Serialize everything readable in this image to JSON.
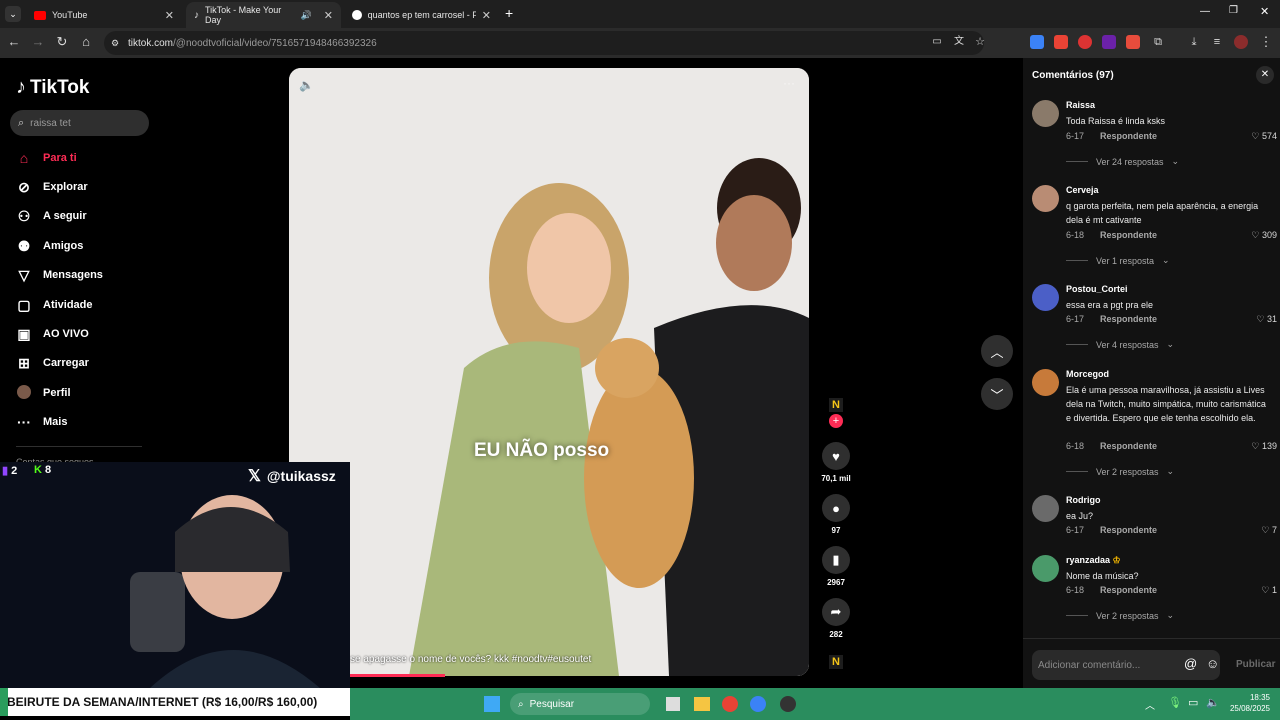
{
  "browser": {
    "tabs": [
      {
        "title": "YouTube",
        "active": false
      },
      {
        "title": "TikTok - Make Your Day",
        "active": true
      },
      {
        "title": "quantos ep tem carrosel - Pesq",
        "active": false
      }
    ],
    "url_host": "tiktok.com",
    "url_path": "/@noodtvoficial/video/7516571948466392326"
  },
  "sidebar": {
    "logo": "TikTok",
    "search_placeholder": "raissa tet",
    "items": [
      {
        "label": "Para ti",
        "icon": "home-icon",
        "active": true
      },
      {
        "label": "Explorar",
        "icon": "compass-icon"
      },
      {
        "label": "A seguir",
        "icon": "following-icon"
      },
      {
        "label": "Amigos",
        "icon": "friends-icon"
      },
      {
        "label": "Mensagens",
        "icon": "messages-icon"
      },
      {
        "label": "Atividade",
        "icon": "activity-icon"
      },
      {
        "label": "AO VIVO",
        "icon": "live-icon"
      },
      {
        "label": "Carregar",
        "icon": "upload-icon"
      },
      {
        "label": "Perfil",
        "icon": "profile-icon"
      },
      {
        "label": "Mais",
        "icon": "more-icon"
      }
    ],
    "partial_text": "Contas que segues"
  },
  "video": {
    "overlay_text": "EU NÃO posso",
    "caption": "se apagasse o nome de vocês? kkk #noodtv#eusoutet",
    "likes": "70,1 mil",
    "comments": "97",
    "saves": "2967",
    "shares": "282"
  },
  "comments": {
    "title": "Comentários (97)",
    "placeholder": "Adicionar comentário...",
    "post_label": "Publicar",
    "items": [
      {
        "user": "Raissa",
        "text": "Toda Raissa é linda ksks",
        "date": "6-17",
        "reply": "Respondente",
        "likes": "574",
        "replies": "Ver 24 respostas"
      },
      {
        "user": "Cerveja",
        "text": "q garota perfeita, nem pela aparência, a energia dela é mt cativante",
        "date": "6-18",
        "reply": "Respondente",
        "likes": "309",
        "replies": "Ver 1 resposta"
      },
      {
        "user": "Postou_Cortei",
        "text": "essa era a pgt pra ele",
        "date": "6-17",
        "reply": "Respondente",
        "likes": "31",
        "replies": "Ver 4 respostas"
      },
      {
        "user": "Morcegod",
        "text": "Ela é uma pessoa maravilhosa, já assistiu a Lives dela na Twitch, muito simpática, muito carismática e divertida. Espero que ele tenha escolhido ela.",
        "date": "6-18",
        "reply": "Respondente",
        "likes": "139",
        "replies": "Ver 2 respostas"
      },
      {
        "user": "Rodrigo",
        "text": "ea Ju?",
        "date": "6-17",
        "reply": "Respondente",
        "likes": "7",
        "replies": ""
      },
      {
        "user": "ryanzadaa",
        "text": "Nome da música?",
        "date": "6-18",
        "reply": "Respondente",
        "likes": "1",
        "replies": "Ver 2 respostas"
      }
    ]
  },
  "stream": {
    "handle": "@tuikassz",
    "count_a": "2",
    "count_b": "8",
    "banner": "BEIRUTE DA SEMANA/INTERNET (R$ 16,00/R$ 160,00)"
  },
  "taskbar": {
    "search": "Pesquisar",
    "time": "18:35",
    "date": "25/08/2025"
  },
  "colors": {
    "accent": "#fe2c55",
    "taskbar": "#2a8d5e"
  }
}
